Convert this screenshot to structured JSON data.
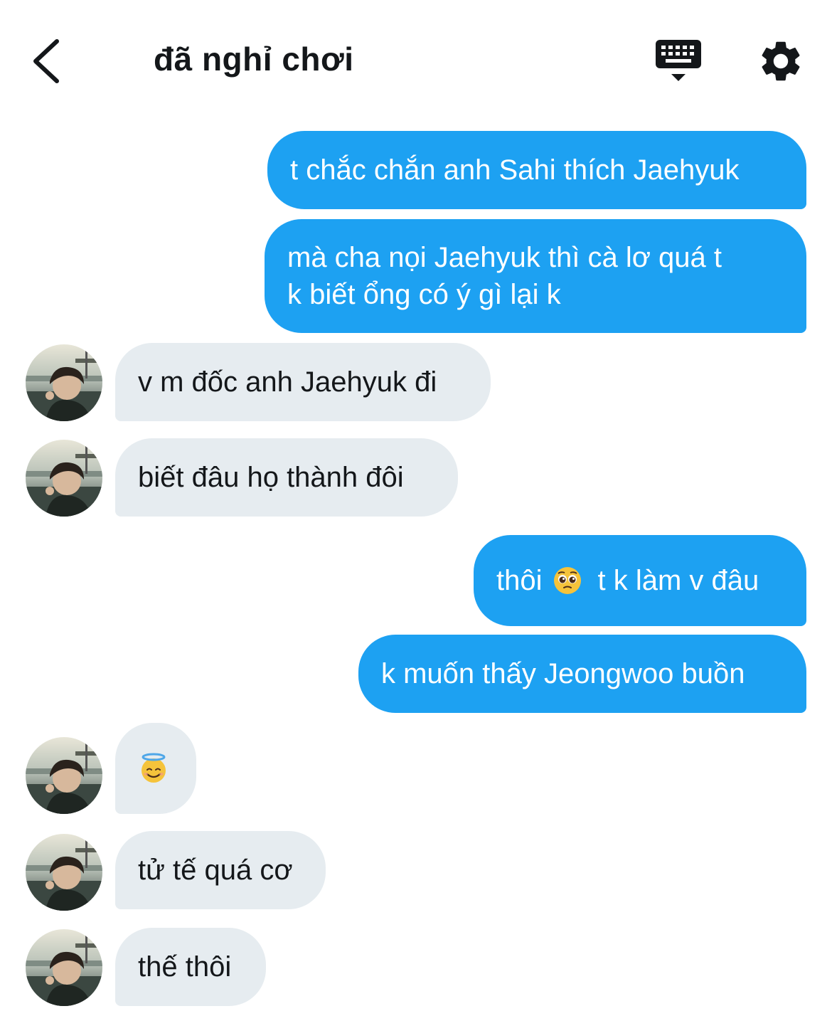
{
  "header": {
    "title": "đã nghỉ chơi",
    "back_icon": "chevron-left-icon",
    "keyboard_icon": "keyboard-icon",
    "settings_icon": "gear-icon"
  },
  "colors": {
    "outgoing_bubble": "#1da1f2",
    "incoming_bubble": "#e6ecf0",
    "text_dark": "#14171a"
  },
  "messages": [
    {
      "direction": "out",
      "text": "t chắc chắn anh Sahi thích Jaehyuk"
    },
    {
      "direction": "out",
      "line1": "mà cha nọi Jaehyuk thì cà lơ quá t",
      "line2": "k biết ổng có ý gì lại k"
    },
    {
      "direction": "in",
      "text": "v m đốc anh Jaehyuk đi"
    },
    {
      "direction": "in",
      "text": "biết đâu họ thành đôi"
    },
    {
      "direction": "out",
      "text_before": "thôi",
      "emoji": "pleading-face-emoji",
      "text_after": "t k làm v đâu"
    },
    {
      "direction": "out",
      "text": "k muốn thấy Jeongwoo buồn"
    },
    {
      "direction": "in",
      "emoji": "smiling-face-with-halo-emoji"
    },
    {
      "direction": "in",
      "text": "tử tế quá cơ"
    },
    {
      "direction": "in",
      "text": "thế thôi"
    }
  ]
}
